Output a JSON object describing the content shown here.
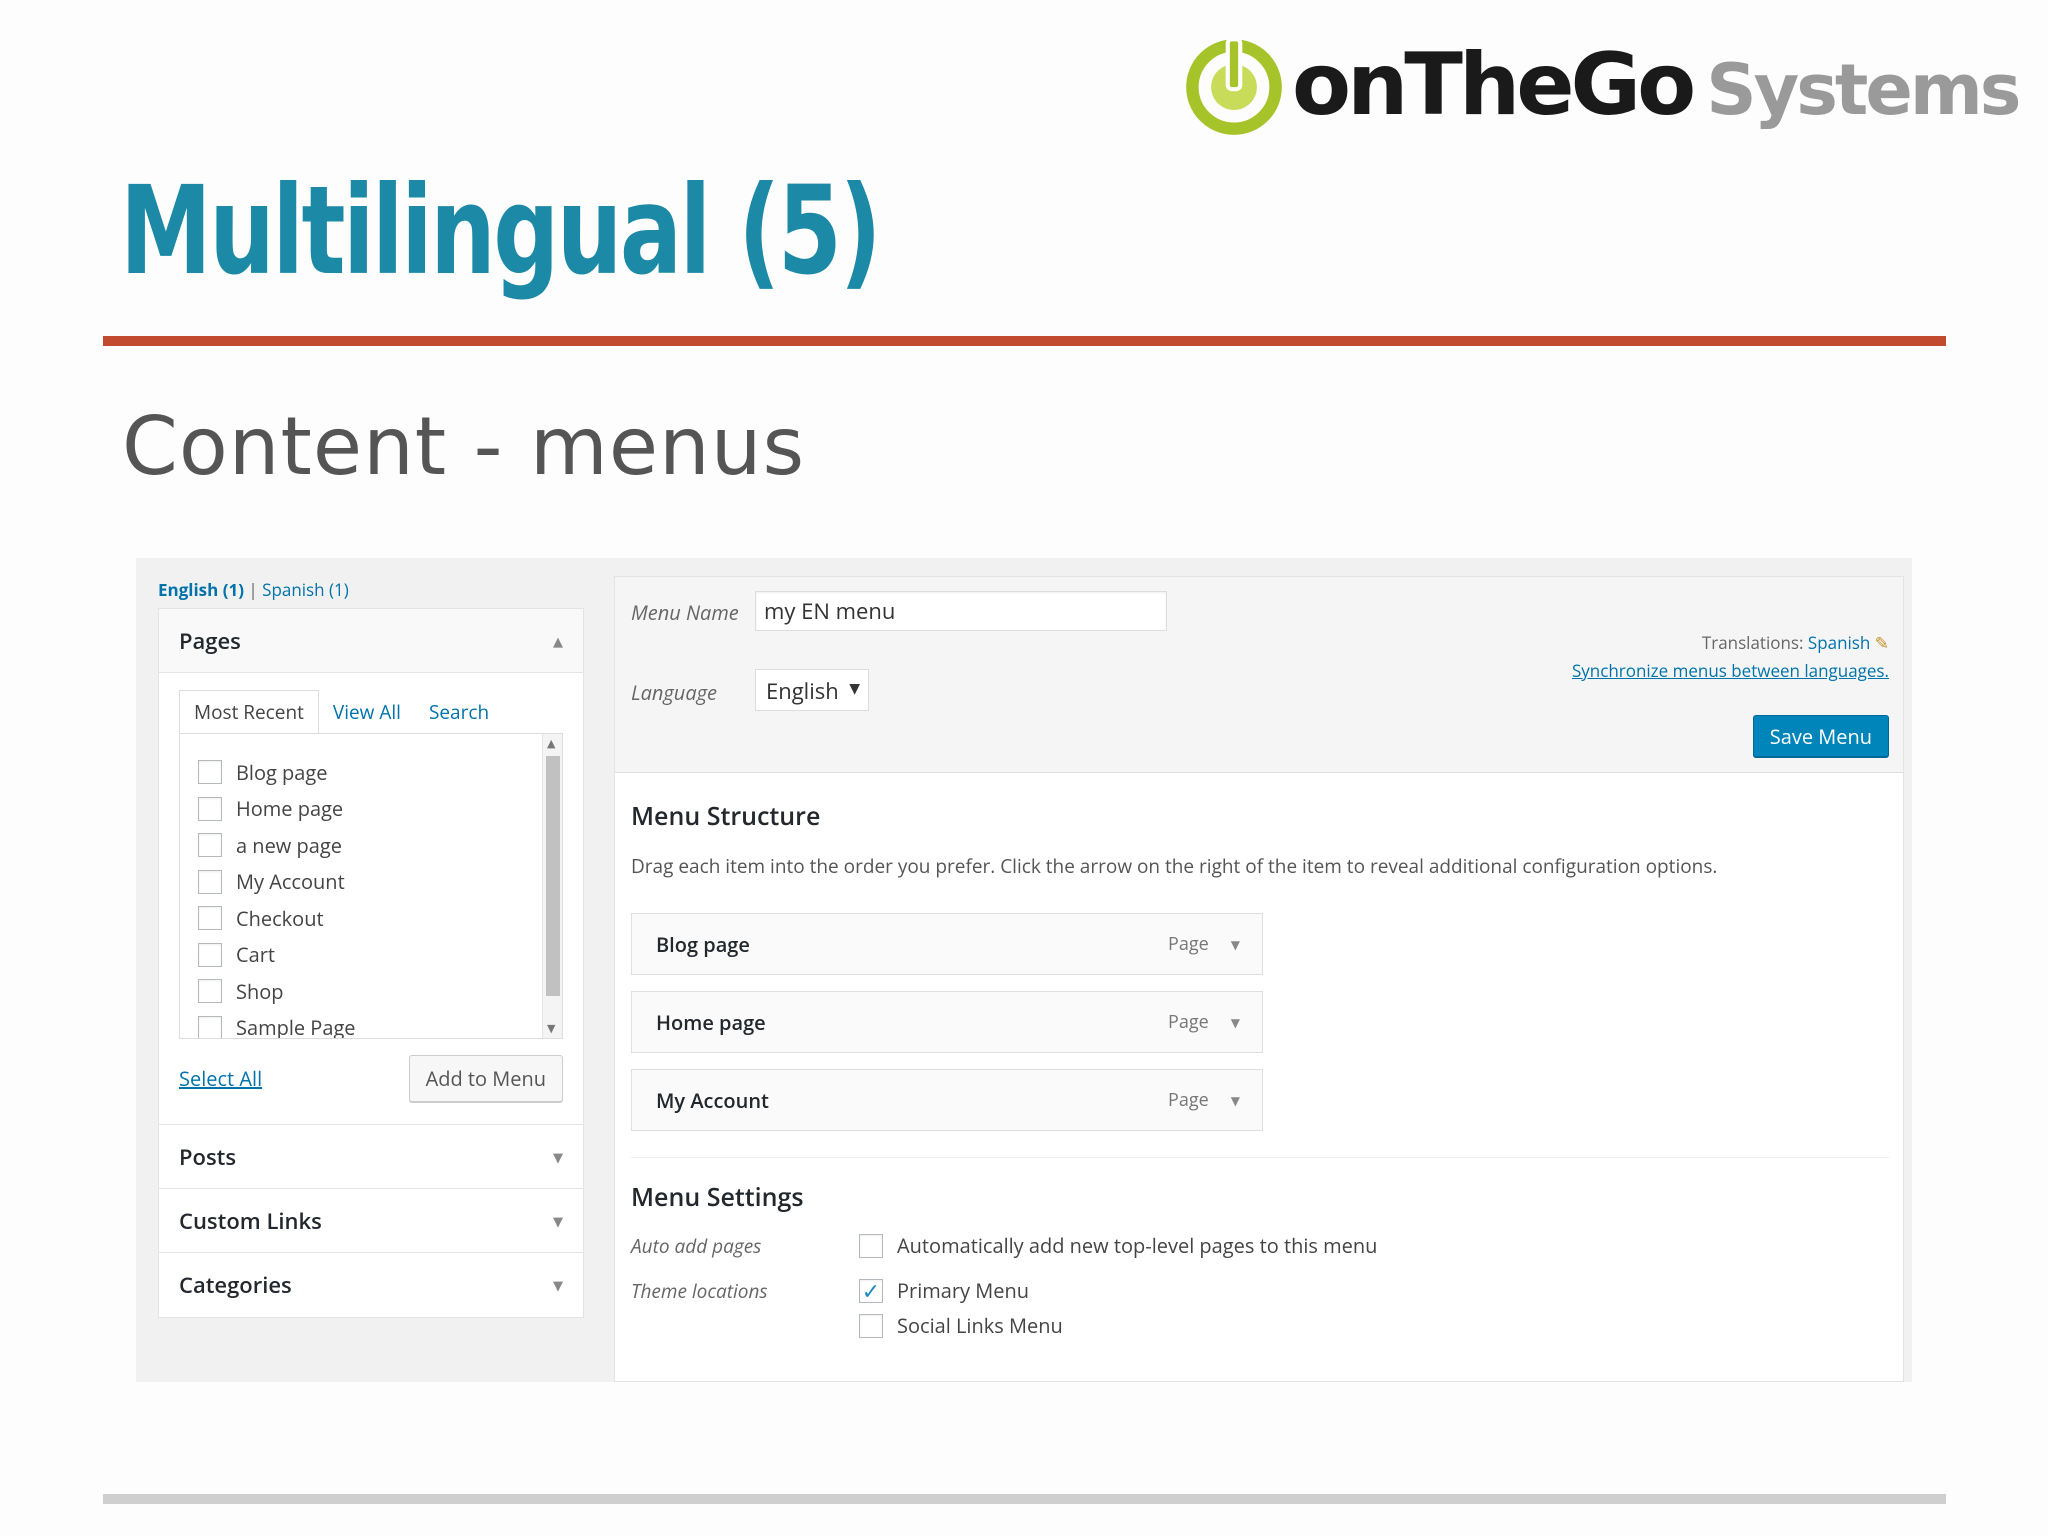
{
  "logo": {
    "icon": "power-icon",
    "brand_bold": "onTheGo",
    "brand_light": "Systems",
    "colors": {
      "power": "#a6c42a",
      "bold": "#1a1a1a",
      "light": "#9a9a9a"
    }
  },
  "slide": {
    "title": "Multilingual (5)",
    "subtitle": "Content - menus",
    "colors": {
      "title": "#1c8aa6",
      "rule": "#c24a2e"
    }
  },
  "language_switcher": {
    "current": "English (1)",
    "separator": "|",
    "other": "Spanish (1)"
  },
  "pages_panel": {
    "heading": "Pages",
    "tabs": [
      {
        "label": "Most Recent"
      },
      {
        "label": "View All"
      },
      {
        "label": "Search"
      }
    ],
    "items": [
      "Blog page",
      "Home page",
      "a new page",
      "My Account",
      "Checkout",
      "Cart",
      "Shop",
      "Sample Page"
    ],
    "select_all": "Select All",
    "add_button": "Add to Menu"
  },
  "collapsed_panels": [
    {
      "label": "Posts"
    },
    {
      "label": "Custom Links"
    },
    {
      "label": "Categories"
    }
  ],
  "editor": {
    "menu_name_label": "Menu Name",
    "menu_name_value": "my EN menu",
    "language_label": "Language",
    "language_value": "English",
    "translations_label": "Translations:",
    "translations_link": "Spanish",
    "sync_link": "Synchronize menus between languages.",
    "save_button": "Save Menu",
    "accent_color": "#0085ba"
  },
  "structure": {
    "heading": "Menu Structure",
    "description": "Drag each item into the order you prefer. Click the arrow on the right of the item to reveal additional configuration options.",
    "items": [
      {
        "title": "Blog page",
        "type": "Page"
      },
      {
        "title": "Home page",
        "type": "Page"
      },
      {
        "title": "My Account",
        "type": "Page"
      }
    ]
  },
  "settings": {
    "heading": "Menu Settings",
    "auto_add_label": "Auto add pages",
    "auto_add_option": "Automatically add new top-level pages to this menu",
    "auto_add_checked": false,
    "theme_locations_label": "Theme locations",
    "locations": [
      {
        "label": "Primary Menu",
        "checked": true
      },
      {
        "label": "Social Links Menu",
        "checked": false
      }
    ]
  }
}
